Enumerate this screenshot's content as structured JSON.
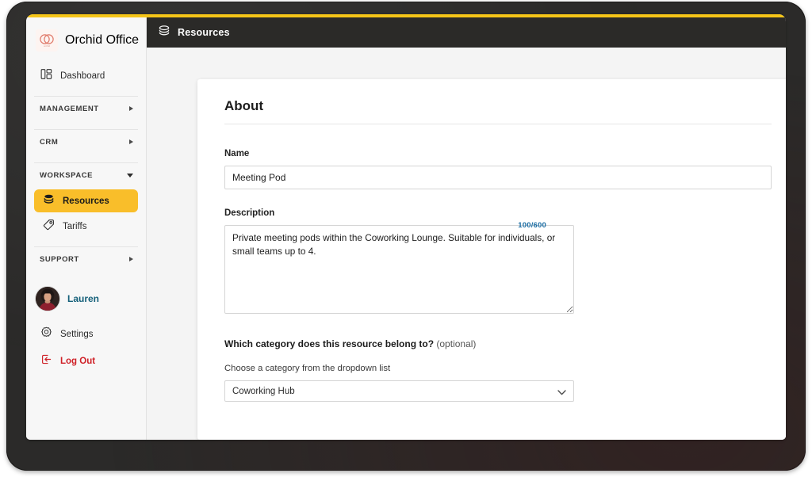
{
  "brand": {
    "name": "Orchid Office",
    "logo_icon": "orchid-rings-logo",
    "logo_color": "#e07a6a",
    "accent_color": "#f5c518"
  },
  "topbar": {
    "title": "Resources",
    "icon": "layers-icon",
    "background_color": "#2b2a28"
  },
  "sidebar": {
    "dashboard": {
      "label": "Dashboard",
      "icon": "layout-dashboard-icon"
    },
    "sections": [
      {
        "label": "MANAGEMENT",
        "expanded": false,
        "chevron": "triangle-right-icon"
      },
      {
        "label": "CRM",
        "expanded": false,
        "chevron": "triangle-right-icon"
      },
      {
        "label": "WORKSPACE",
        "expanded": true,
        "chevron": "triangle-down-icon"
      },
      {
        "label": "SUPPORT",
        "expanded": false,
        "chevron": "triangle-right-icon"
      }
    ],
    "workspace_items": [
      {
        "label": "Resources",
        "icon": "layers-icon",
        "active": true,
        "active_color": "#f9be2a"
      },
      {
        "label": "Tariffs",
        "icon": "price-tag-icon",
        "active": false
      }
    ],
    "user": {
      "name": "Lauren",
      "avatar": "user-avatar-photo",
      "name_color": "#15607a"
    },
    "settings": {
      "label": "Settings",
      "icon": "gear-icon"
    },
    "logout": {
      "label": "Log Out",
      "icon": "logout-arrow-icon",
      "color": "#cf2027"
    }
  },
  "main": {
    "card_title": "About",
    "name_field": {
      "label": "Name",
      "value": "Meeting Pod",
      "placeholder": "Name"
    },
    "description_field": {
      "label": "Description",
      "value": "Private meeting pods within the Coworking Lounge. Suitable for individuals, or small teams up to 4.",
      "placeholder": "Description",
      "counter": "100/600",
      "counter_color": "#1c6ea4"
    },
    "category_field": {
      "question": "Which category does this resource belong to?",
      "optional_tag": "(optional)",
      "hint": "Choose a category from the dropdown list",
      "selected": "Coworking Hub",
      "chevron": "chevron-down-icon"
    }
  }
}
